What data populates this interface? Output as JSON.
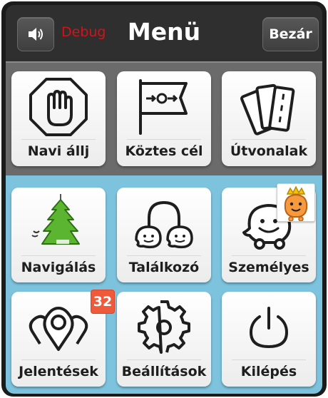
{
  "header": {
    "sound_icon": "speaker-icon",
    "debug_label": "Debug",
    "title": "Menü",
    "close_label": "Bezár"
  },
  "menu": {
    "stop": {
      "label": "Navi állj",
      "icon": "stop-hand-icon"
    },
    "waypoint": {
      "label": "Köztes cél",
      "icon": "waypoint-flag-icon"
    },
    "routes": {
      "label": "Útvonalak",
      "icon": "route-cards-icon"
    },
    "navigate": {
      "label": "Navigálás",
      "icon": "air-freshener-tree-icon"
    },
    "meetup": {
      "label": "Találkozó",
      "icon": "meetup-wazers-icon"
    },
    "personal": {
      "label": "Személyes",
      "icon": "wazer-car-icon"
    },
    "reports": {
      "label": "Jelentések",
      "icon": "report-pins-icon"
    },
    "settings": {
      "label": "Beállítások",
      "icon": "gear-icon"
    },
    "exit": {
      "label": "Kilépés",
      "icon": "power-icon"
    }
  },
  "badges": {
    "reports_count": "32"
  },
  "colors": {
    "header_bg": "#2f2f2f",
    "top_section_bg": "#6b6b6b",
    "bottom_section_bg": "#7dc3dd",
    "debug_text": "#d2141a",
    "badge_bg": "#ef5a3c",
    "tree_green": "#5cb531"
  }
}
